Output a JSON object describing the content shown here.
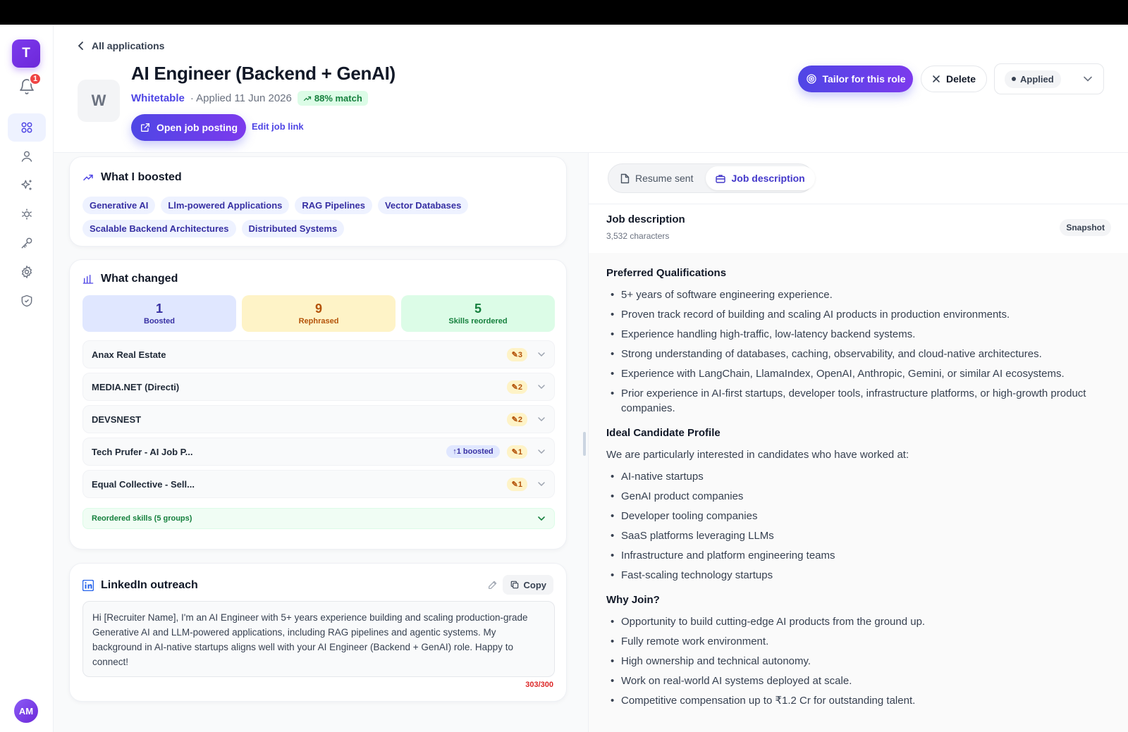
{
  "sidebar": {
    "logo_letter": "T",
    "notification_count": "1",
    "avatar_initials": "AM",
    "nav_icons": [
      "dashboard-icon",
      "profile-icon",
      "sparkles-icon",
      "interview-icon",
      "key-icon",
      "settings-icon",
      "shield-icon"
    ]
  },
  "header": {
    "back_label": "All applications",
    "company_logo_letter": "W",
    "job_title": "AI Engineer (Backend + GenAI)",
    "company": "Whitetable",
    "applied_text": "· Applied 11 Jun 2026",
    "match": "88% match",
    "open_posting_label": "Open job posting",
    "edit_link_label": "Edit job link",
    "tailor_label": "Tailor for this role",
    "delete_label": "Delete",
    "status_value": "Applied"
  },
  "boosted": {
    "title": "What I boosted",
    "tags": [
      "Generative AI",
      "Llm-powered Applications",
      "RAG Pipelines",
      "Vector Databases",
      "Scalable Backend Architectures",
      "Distributed Systems"
    ]
  },
  "changed": {
    "title": "What changed",
    "stats": [
      {
        "num": "1",
        "label": "Boosted"
      },
      {
        "num": "9",
        "label": "Rephrased"
      },
      {
        "num": "5",
        "label": "Skills reordered"
      }
    ],
    "experiences": [
      {
        "name": "Anax Real Estate",
        "edits": "✎3",
        "boost": ""
      },
      {
        "name": "MEDIA.NET (Directi)",
        "edits": "✎2",
        "boost": ""
      },
      {
        "name": "DEVSNEST",
        "edits": "✎2",
        "boost": ""
      },
      {
        "name": "Tech Prufer - AI Job P...",
        "edits": "✎1",
        "boost": "↑1 boosted"
      },
      {
        "name": "Equal Collective - Sell...",
        "edits": "✎1",
        "boost": ""
      }
    ],
    "skills_label": "Reordered skills (5 groups)"
  },
  "outreach": {
    "title": "LinkedIn outreach",
    "copy_label": "Copy",
    "message": "Hi [Recruiter Name], I'm an AI Engineer with 5+ years experience building and scaling production-grade Generative AI and LLM-powered applications, including RAG pipelines and agentic systems. My background in AI-native startups aligns well with your AI Engineer (Backend + GenAI) role. Happy to connect!",
    "char_count": "303/300"
  },
  "right_panel": {
    "tabs": [
      "Resume sent",
      "Job description"
    ],
    "jd_title": "Job description",
    "jd_chars": "3,532 characters",
    "snapshot_label": "Snapshot",
    "sections": [
      {
        "heading": "Preferred Qualifications",
        "intro": "",
        "items": [
          "5+ years of software engineering experience.",
          "Proven track record of building and scaling AI products in production environments.",
          "Experience handling high-traffic, low-latency backend systems.",
          "Strong understanding of databases, caching, observability, and cloud-native architectures.",
          "Experience with LangChain, LlamaIndex, OpenAI, Anthropic, Gemini, or similar AI ecosystems.",
          "Prior experience in AI-first startups, developer tools, infrastructure platforms, or high-growth product companies."
        ]
      },
      {
        "heading": "Ideal Candidate Profile",
        "intro": "We are particularly interested in candidates who have worked at:",
        "items": [
          "AI-native startups",
          "GenAI product companies",
          "Developer tooling companies",
          "SaaS platforms leveraging LLMs",
          "Infrastructure and platform engineering teams",
          "Fast-scaling technology startups"
        ]
      },
      {
        "heading": "Why Join?",
        "intro": "",
        "items": [
          "Opportunity to build cutting-edge AI products from the ground up.",
          "Fully remote work environment.",
          "High ownership and technical autonomy.",
          "Work on real-world AI systems deployed at scale.",
          "Competitive compensation up to ₹1.2 Cr for outstanding talent."
        ]
      }
    ]
  },
  "colors": {
    "accent": "#4f46e5",
    "accent_purple": "#7c3aed",
    "boost_bg": "#e0e7ff",
    "rephrase_bg": "#fef3c7",
    "skills_bg": "#dcfce7",
    "danger": "#dc2626"
  }
}
